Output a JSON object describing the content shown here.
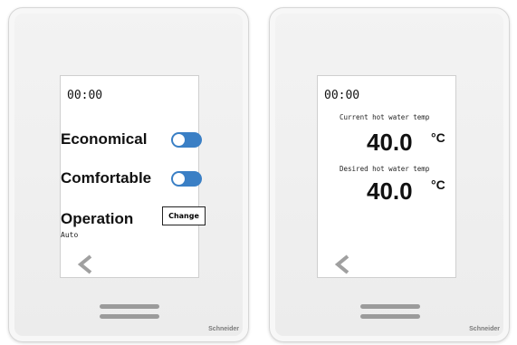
{
  "left_panel": {
    "time": "00:00",
    "economical_label": "Economical",
    "comfortable_label": "Comfortable",
    "operation_label": "Operation",
    "operation_value": "Auto",
    "change_button": "Change",
    "brand": "Schneider"
  },
  "right_panel": {
    "time": "00:00",
    "current_label": "Current hot water temp",
    "current_value": "40.0",
    "desired_label": "Desired hot water temp",
    "desired_value": "40.0",
    "unit": "°C",
    "brand": "Schneider"
  },
  "colors": {
    "toggle": "#3a7fc5",
    "chevron": "#a0a0a0"
  },
  "icons": {
    "back": "chevron-left-icon"
  }
}
